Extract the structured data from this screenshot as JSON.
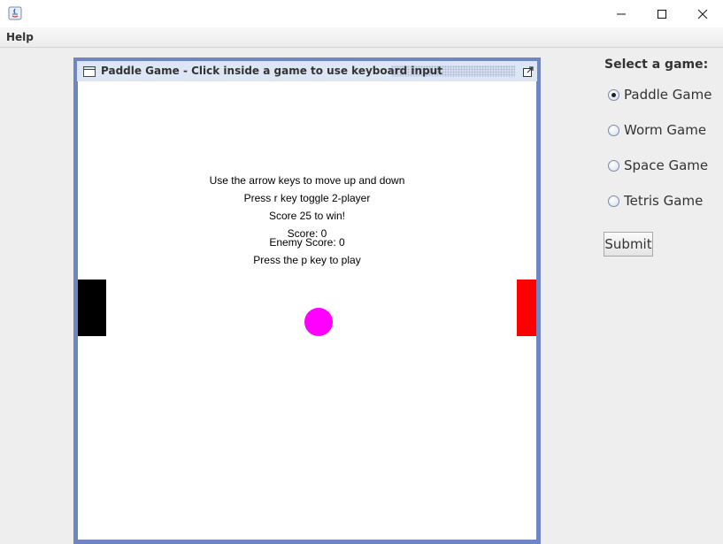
{
  "window": {
    "minimize_icon": "minimize-icon",
    "maximize_icon": "maximize-icon",
    "close_icon": "close-icon"
  },
  "menu": {
    "items": [
      "Help"
    ]
  },
  "game_frame": {
    "title": "Paddle Game - Click inside a game to use keyboard input",
    "instructions": [
      "Use the arrow keys to move up and down",
      "Press r key toggle 2-player",
      "Score 25 to win!"
    ],
    "score_label": "Score: 0",
    "enemy_score_label": "Enemy Score: 0",
    "play_prompt": "Press the p key to play",
    "player_score": 0,
    "enemy_score": 0,
    "colors": {
      "player_paddle": "#000000",
      "enemy_paddle": "#ff0000",
      "ball": "#ff00ff",
      "frame_border": "#6f86c2"
    }
  },
  "panel": {
    "heading": "Select a game:",
    "options": [
      {
        "label": "Paddle Game",
        "selected": true
      },
      {
        "label": "Worm Game",
        "selected": false
      },
      {
        "label": "Space Game",
        "selected": false
      },
      {
        "label": "Tetris Game",
        "selected": false
      }
    ],
    "submit_label": "Submit"
  }
}
